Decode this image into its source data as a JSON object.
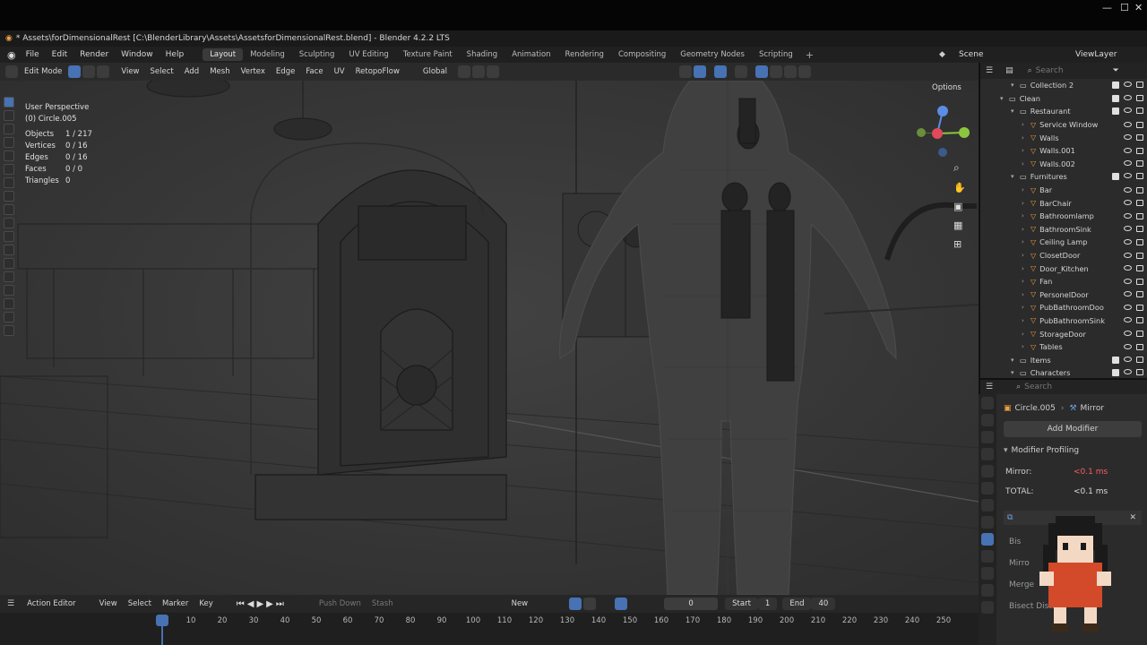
{
  "window": {
    "title": "* Assets\\forDimensionalRest [C:\\BlenderLibrary\\Assets\\AssetsforDimensionalRest.blend] - Blender 4.2.2 LTS",
    "minimize": "—",
    "maximize": "☐",
    "close": "✕"
  },
  "menus": [
    "File",
    "Edit",
    "Render",
    "Window",
    "Help"
  ],
  "workspaces": [
    "Layout",
    "Modeling",
    "Sculpting",
    "UV Editing",
    "Texture Paint",
    "Shading",
    "Animation",
    "Rendering",
    "Compositing",
    "Geometry Nodes",
    "Scripting"
  ],
  "active_workspace": "Layout",
  "scene": "Scene",
  "view_layer": "ViewLayer",
  "viewport_header": {
    "mode": "Edit Mode",
    "menus": [
      "View",
      "Select",
      "Add",
      "Mesh",
      "Vertex",
      "Edge",
      "Face",
      "UV"
    ],
    "addon": "RetopoFlow",
    "orientation": "Global",
    "options": "Options"
  },
  "overlay": {
    "view": "User Perspective",
    "object": "(0) Circle.005",
    "stats": [
      {
        "label": "Objects",
        "value": "1 / 217"
      },
      {
        "label": "Vertices",
        "value": "0 / 16"
      },
      {
        "label": "Edges",
        "value": "0 / 16"
      },
      {
        "label": "Faces",
        "value": "0 / 0"
      },
      {
        "label": "Triangles",
        "value": "0"
      }
    ]
  },
  "outliner": {
    "search_placeholder": "Search",
    "rows": [
      {
        "name": "Collection 2",
        "indent": 2,
        "type": "col"
      },
      {
        "name": "Clean",
        "indent": 1,
        "type": "col"
      },
      {
        "name": "Restaurant",
        "indent": 2,
        "type": "col"
      },
      {
        "name": "Service Window",
        "indent": 3,
        "type": "obj"
      },
      {
        "name": "Walls",
        "indent": 3,
        "type": "obj"
      },
      {
        "name": "Walls.001",
        "indent": 3,
        "type": "obj"
      },
      {
        "name": "Walls.002",
        "indent": 3,
        "type": "obj"
      },
      {
        "name": "Furnitures",
        "indent": 2,
        "type": "col"
      },
      {
        "name": "Bar",
        "indent": 3,
        "type": "obj"
      },
      {
        "name": "BarChair",
        "indent": 3,
        "type": "obj"
      },
      {
        "name": "Bathroomlamp",
        "indent": 3,
        "type": "obj"
      },
      {
        "name": "BathroomSink",
        "indent": 3,
        "type": "obj"
      },
      {
        "name": "Ceiling Lamp",
        "indent": 3,
        "type": "obj"
      },
      {
        "name": "ClosetDoor",
        "indent": 3,
        "type": "obj"
      },
      {
        "name": "Door_Kitchen",
        "indent": 3,
        "type": "obj"
      },
      {
        "name": "Fan",
        "indent": 3,
        "type": "obj"
      },
      {
        "name": "PersonelDoor",
        "indent": 3,
        "type": "obj"
      },
      {
        "name": "PubBathroomDoo",
        "indent": 3,
        "type": "obj"
      },
      {
        "name": "PubBathroomSink",
        "indent": 3,
        "type": "obj"
      },
      {
        "name": "StorageDoor",
        "indent": 3,
        "type": "obj"
      },
      {
        "name": "Tables",
        "indent": 3,
        "type": "obj"
      },
      {
        "name": "Items",
        "indent": 2,
        "type": "col"
      },
      {
        "name": "Characters",
        "indent": 2,
        "type": "col"
      }
    ]
  },
  "properties": {
    "search_placeholder": "Search",
    "object": "Circle.005",
    "modifier": "Mirror",
    "add_modifier": "Add Modifier",
    "profiling_title": "Modifier Profiling",
    "profiling": [
      {
        "label": "Mirror:",
        "value": "<0.1 ms"
      },
      {
        "label": "TOTAL:",
        "value": "<0.1 ms"
      }
    ],
    "partial_labels": [
      "Bis",
      "Mirro",
      "Merge",
      "Bisect Dist."
    ]
  },
  "timeline": {
    "editor": "Action Editor",
    "menus": [
      "View",
      "Select",
      "Marker",
      "Key"
    ],
    "push_down": "Push Down",
    "stash": "Stash",
    "new": "New",
    "current_frame": "0",
    "start_label": "Start",
    "start": "1",
    "end_label": "End",
    "end": "40",
    "ticks": [
      "0",
      "10",
      "20",
      "30",
      "40",
      "50",
      "60",
      "70",
      "80",
      "90",
      "100",
      "110",
      "120",
      "130",
      "140",
      "150",
      "160",
      "170",
      "180",
      "190",
      "200",
      "210",
      "220",
      "230",
      "240",
      "250"
    ]
  },
  "colors": {
    "accent": "#4772b3",
    "frame_indicator": "#4772b3",
    "object_icon": "#f0a040",
    "modifier_icon": "#4ec96b",
    "profiling_value": "#ff5c5c"
  }
}
